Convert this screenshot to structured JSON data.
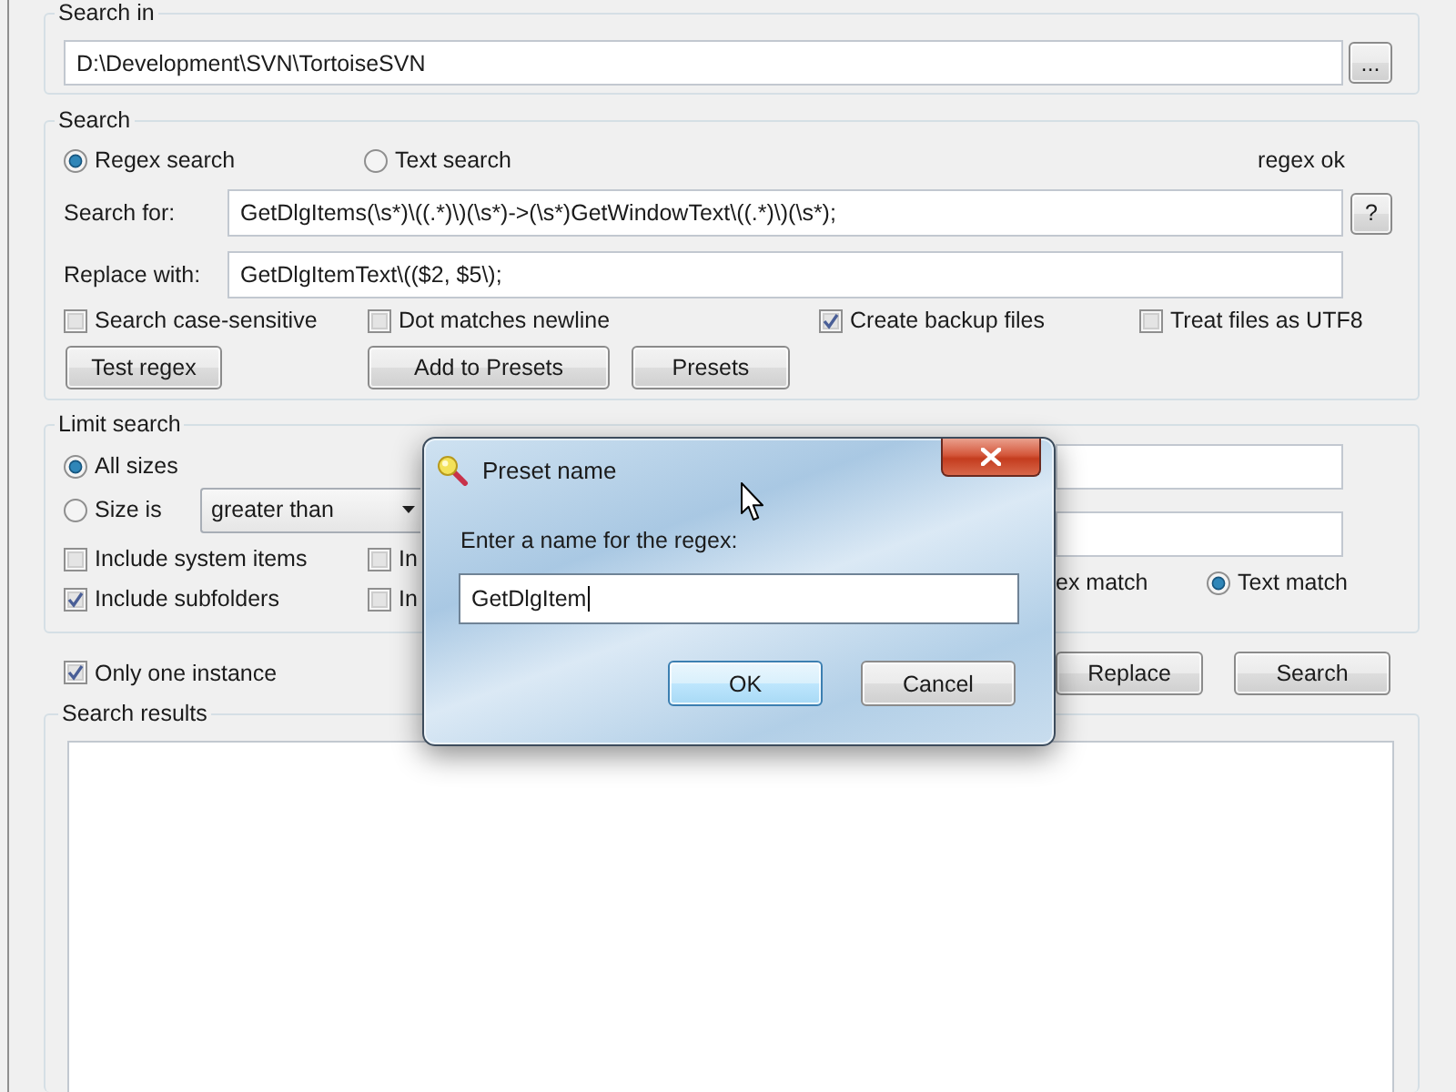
{
  "search_in": {
    "label": "Search in",
    "path": "D:\\Development\\SVN\\TortoiseSVN",
    "browse_button": "..."
  },
  "search": {
    "label": "Search",
    "modes": [
      {
        "label": "Regex search",
        "selected": true
      },
      {
        "label": "Text search",
        "selected": false
      }
    ],
    "status": "regex ok",
    "search_for": {
      "label": "Search for:",
      "value": "GetDlgItems(\\s*)\\((.*)\\)(\\s*)->(\\s*)GetWindowText\\((.*)\\)(\\s*);"
    },
    "help_button": "?",
    "replace_with": {
      "label": "Replace with:",
      "value": "GetDlgItemText\\(($2, $5\\);"
    },
    "options": [
      {
        "label": "Search case-sensitive",
        "checked": false
      },
      {
        "label": "Dot matches newline",
        "checked": false
      },
      {
        "label": "Create backup files",
        "checked": true
      },
      {
        "label": "Treat files as UTF8",
        "checked": false
      }
    ],
    "buttons": [
      "Test regex",
      "Add to Presets",
      "Presets"
    ]
  },
  "limit_search": {
    "label": "Limit search",
    "size_modes": [
      {
        "label": "All sizes",
        "selected": true
      },
      {
        "label": "Size is",
        "selected": false
      }
    ],
    "size_comparison": "greater than",
    "options": [
      {
        "label": "Include system items",
        "checked": false
      },
      {
        "label": "Include subfolders",
        "checked": true
      }
    ],
    "covered_options": [
      {
        "label": "In",
        "checked": false
      },
      {
        "label": "In",
        "checked": false
      }
    ],
    "covered_match_label": "ex match",
    "text_match": {
      "label": "Text match",
      "selected": true
    }
  },
  "only_one_instance": {
    "label": "Only one instance",
    "checked": true
  },
  "action_buttons": [
    "Replace",
    "Search"
  ],
  "search_results": {
    "label": "Search results"
  },
  "preset_dialog": {
    "title": "Preset name",
    "prompt": "Enter a name for the regex:",
    "value": "GetDlgItem",
    "buttons": [
      {
        "label": "OK",
        "default": true
      },
      {
        "label": "Cancel",
        "default": false
      }
    ]
  }
}
